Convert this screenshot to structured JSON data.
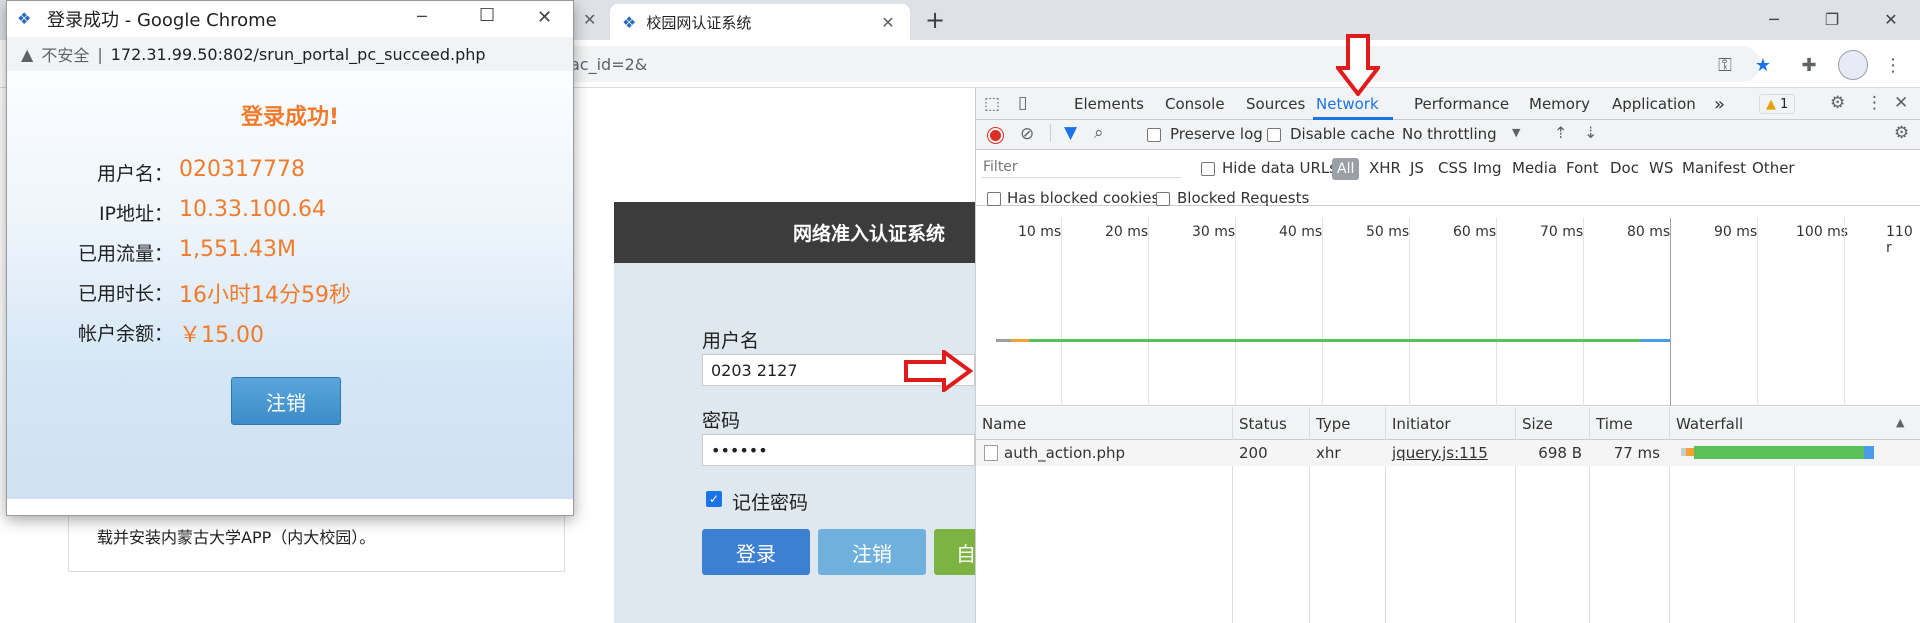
{
  "main_window": {
    "tabs": [
      {
        "title": "校园网认证系统",
        "close": "✕"
      }
    ],
    "new_tab": "+",
    "address_fragment": "ac_id=2&",
    "controls": {
      "minimize": "─",
      "restore": "❐",
      "close": "✕"
    }
  },
  "popup": {
    "window_title": "登录成功 - Google Chrome",
    "insecure_label": "不安全",
    "separator": "|",
    "url": "172.31.99.50:802/srun_portal_pc_succeed.php",
    "heading": "登录成功!",
    "rows": [
      {
        "label": "用户名：",
        "value": "020317778"
      },
      {
        "label": "IP地址：",
        "value": "10.33.100.64"
      },
      {
        "label": "已用流量：",
        "value": "1,551.43M"
      },
      {
        "label": "已用时长：",
        "value": "16小时14分59秒"
      },
      {
        "label": "帐户余额：",
        "value": "￥15.00"
      }
    ],
    "logout_button": "注销",
    "controls": {
      "minimize": "─",
      "maximize": "☐",
      "close": "✕"
    }
  },
  "portal": {
    "header": "网络准入认证系统",
    "username_label": "用户名",
    "username_value": "0203 2127",
    "password_label": "密码",
    "password_value": "••••••",
    "remember_label": "记住密码",
    "login_button": "登录",
    "logout_button": "注销",
    "third_button": "自",
    "notice": "载并安装内蒙古大学APP（内大校园）。"
  },
  "devtools": {
    "tabs": [
      "Elements",
      "Console",
      "Sources",
      "Network",
      "Performance",
      "Memory",
      "Application"
    ],
    "active_tab": "Network",
    "more_tabs": "»",
    "warning_count": "1",
    "toolbar": {
      "preserve_log": "Preserve log",
      "disable_cache": "Disable cache",
      "throttling": "No throttling"
    },
    "filter_placeholder": "Filter",
    "hide_data_urls": "Hide data URLs",
    "type_filters": [
      "All",
      "XHR",
      "JS",
      "CSS",
      "Img",
      "Media",
      "Font",
      "Doc",
      "WS",
      "Manifest",
      "Other"
    ],
    "has_blocked_cookies": "Has blocked cookies",
    "blocked_requests": "Blocked Requests",
    "timeline_ticks": [
      "10 ms",
      "20 ms",
      "30 ms",
      "40 ms",
      "50 ms",
      "60 ms",
      "70 ms",
      "80 ms",
      "90 ms",
      "100 ms",
      "110 r"
    ],
    "columns": [
      "Name",
      "Status",
      "Type",
      "Initiator",
      "Size",
      "Time",
      "Waterfall"
    ],
    "requests": [
      {
        "name": "auth_action.php",
        "status": "200",
        "type": "xhr",
        "initiator": "jquery.js:115",
        "size": "698 B",
        "time": "77 ms"
      }
    ]
  },
  "colors": {
    "accent_orange": "#f07b2c",
    "button_blue": "#4a90d9",
    "devtools_active": "#1a73e8",
    "annotation_red": "#e01b1b"
  }
}
